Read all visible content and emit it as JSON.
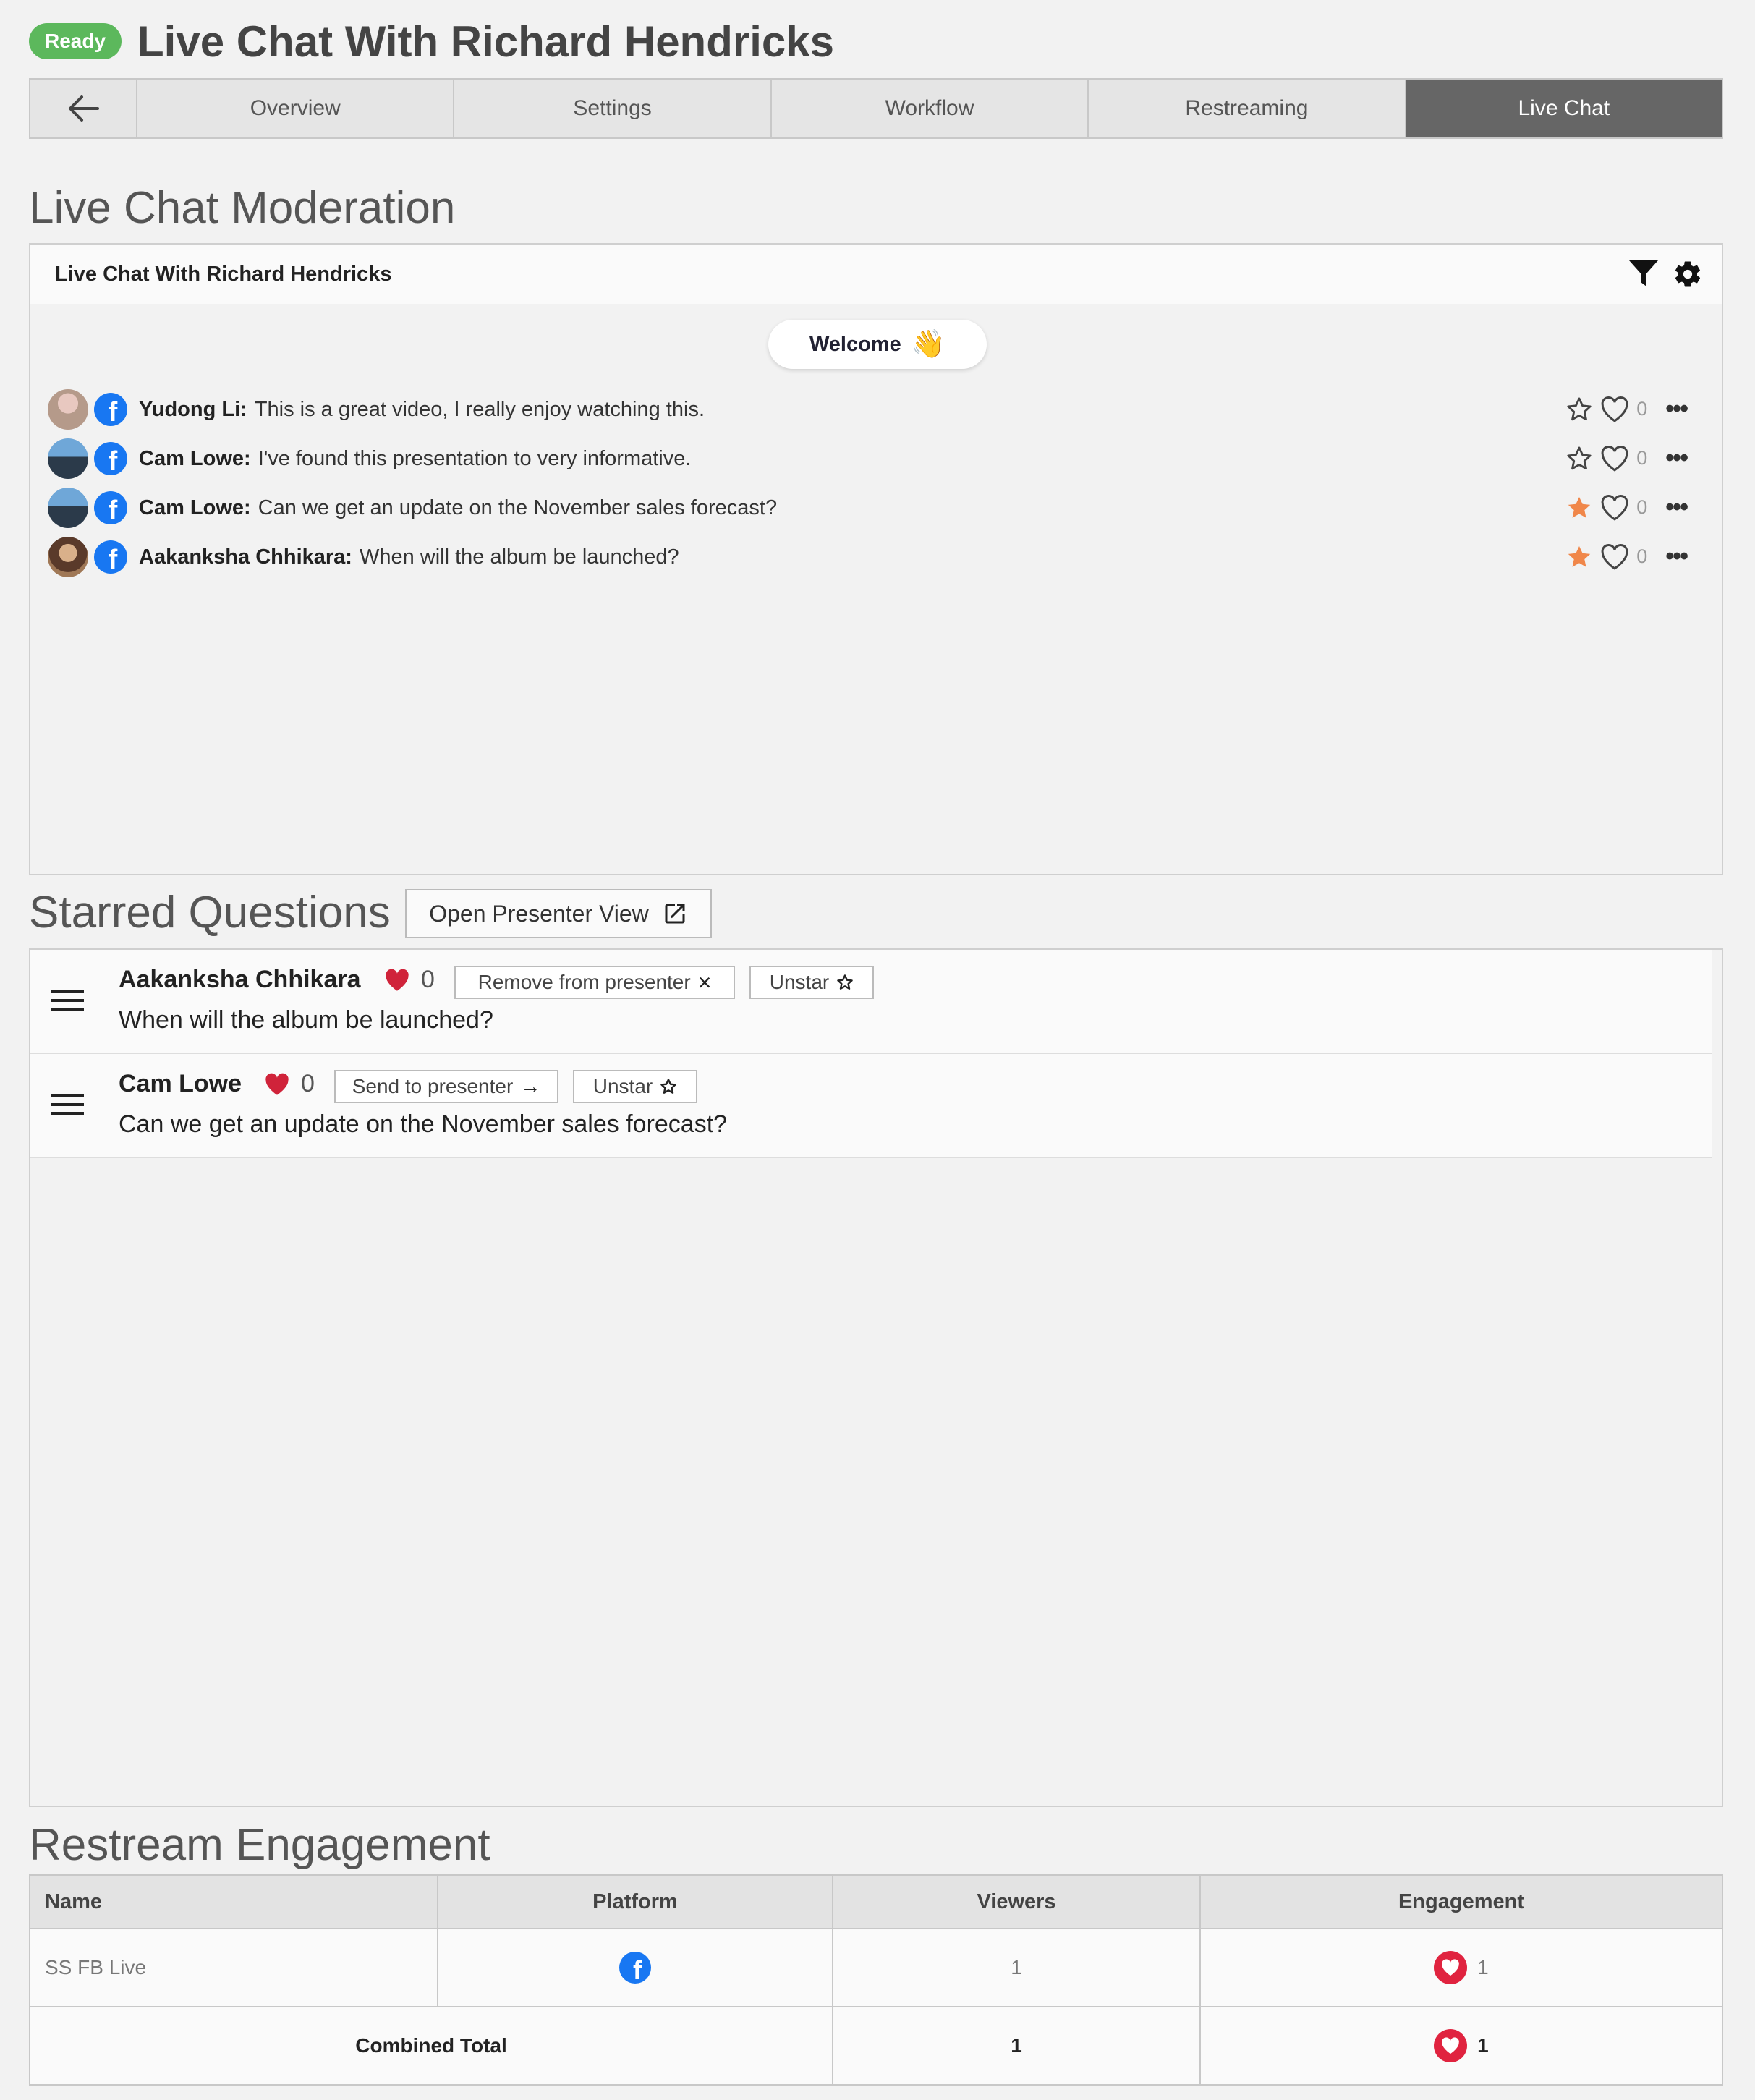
{
  "header": {
    "status": "Ready",
    "title": "Live Chat With Richard Hendricks"
  },
  "tabs": [
    {
      "label": "Overview"
    },
    {
      "label": "Settings"
    },
    {
      "label": "Workflow"
    },
    {
      "label": "Restreaming"
    },
    {
      "label": "Live Chat",
      "active": true
    }
  ],
  "moderation": {
    "section_title": "Live Chat Moderation",
    "panel_title": "Live Chat With Richard Hendricks",
    "welcome_label": "Welcome",
    "welcome_emoji": "👋",
    "messages": [
      {
        "author": "Yudong Li:",
        "text": "This is a great video, I really enjoy watching this.",
        "likes": "0",
        "starred": false,
        "avatar_color": "#b59a8a"
      },
      {
        "author": "Cam Lowe:",
        "text": "I've found this presentation to very informative.",
        "likes": "0",
        "starred": false,
        "avatar_color": "#4f7fa8"
      },
      {
        "author": "Cam Lowe:",
        "text": "Can we get an update on the November sales forecast?",
        "likes": "0",
        "starred": true,
        "avatar_color": "#4f7fa8"
      },
      {
        "author": "Aakanksha Chhikara:",
        "text": "When will the album be launched?",
        "likes": "0",
        "starred": true,
        "avatar_color": "#a07856"
      }
    ]
  },
  "starred": {
    "section_title": "Starred Questions",
    "presenter_view_label": "Open Presenter View",
    "items": [
      {
        "author": "Aakanksha Chhikara",
        "likes": "0",
        "action_label": "Remove from presenter",
        "action_icon": "×",
        "unstar_label": "Unstar",
        "question": "When will the album be launched?"
      },
      {
        "author": "Cam Lowe",
        "likes": "0",
        "action_label": "Send to presenter",
        "action_icon": "→",
        "unstar_label": "Unstar",
        "question": "Can we get an update on the November sales forecast?"
      }
    ]
  },
  "engagement": {
    "section_title": "Restream Engagement",
    "columns": [
      "Name",
      "Platform",
      "Viewers",
      "Engagement"
    ],
    "rows": [
      {
        "name": "SS FB Live",
        "platform": "facebook",
        "viewers": "1",
        "engagement": "1"
      }
    ],
    "total": {
      "label": "Combined Total",
      "viewers": "1",
      "engagement": "1"
    }
  },
  "colors": {
    "ready": "#5cb85c",
    "active_tab": "#666666",
    "facebook": "#1877f2",
    "star_active": "#f0874a",
    "heart": "#d0233a"
  }
}
